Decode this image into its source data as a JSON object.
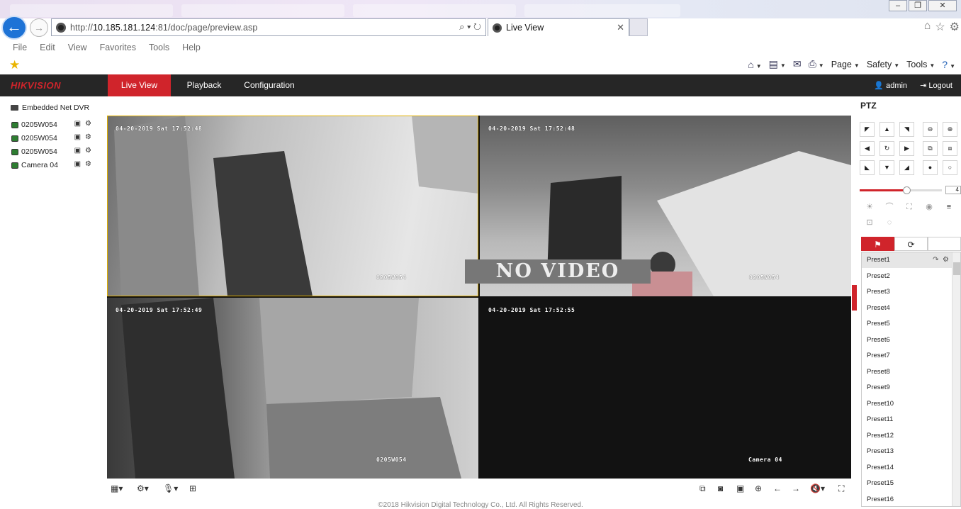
{
  "browser": {
    "window_buttons": [
      "–",
      "❐",
      "✕"
    ],
    "back_icon": "back-arrow-icon",
    "forward_icon": "forward-arrow-icon",
    "address": {
      "prefix": "http://",
      "host": "10.185.181.124",
      "rest": ":81/doc/page/preview.asp"
    },
    "address_tools": "⌕ ▾ ↻",
    "tab_title": "Live View",
    "tab_close": "✕",
    "right_nav": [
      "⌂",
      "☆",
      "⚙"
    ],
    "menu": [
      "File",
      "Edit",
      "View",
      "Favorites",
      "Tools",
      "Help"
    ],
    "command_bar": [
      "Page",
      "Safety",
      "Tools"
    ]
  },
  "app": {
    "logo": "HIKVISION",
    "nav": [
      {
        "label": "Live View",
        "active": true
      },
      {
        "label": "Playback",
        "active": false
      },
      {
        "label": "Configuration",
        "active": false
      }
    ],
    "user": "admin",
    "logout": "Logout",
    "accent": "#d0242b"
  },
  "device_tree": {
    "root": "Embedded Net DVR",
    "cameras": [
      "0205W054",
      "0205W054",
      "0205W054",
      "Camera 04"
    ]
  },
  "tiles": [
    {
      "timestamp": "04-20-2019 Sat 17:52:48",
      "name": "0205W054",
      "selected": true
    },
    {
      "timestamp": "04-20-2019 Sat 17:52:48",
      "name": "0205W054",
      "selected": false
    },
    {
      "timestamp": "04-20-2019 Sat 17:52:49",
      "name": "0205W054",
      "selected": false
    },
    {
      "timestamp": "04-20-2019 Sat 17:52:55",
      "name": "Camera 04",
      "selected": false,
      "no_video": "NO VIDEO"
    }
  ],
  "ptz": {
    "title": "PTZ",
    "speed": 4,
    "speed_max": 7,
    "presets": [
      "Preset1",
      "Preset2",
      "Preset3",
      "Preset4",
      "Preset5",
      "Preset6",
      "Preset7",
      "Preset8",
      "Preset9",
      "Preset10",
      "Preset11",
      "Preset12",
      "Preset13",
      "Preset14",
      "Preset15",
      "Preset16"
    ]
  },
  "footer": "©2018 Hikvision Digital Technology Co., Ltd. All Rights Reserved."
}
